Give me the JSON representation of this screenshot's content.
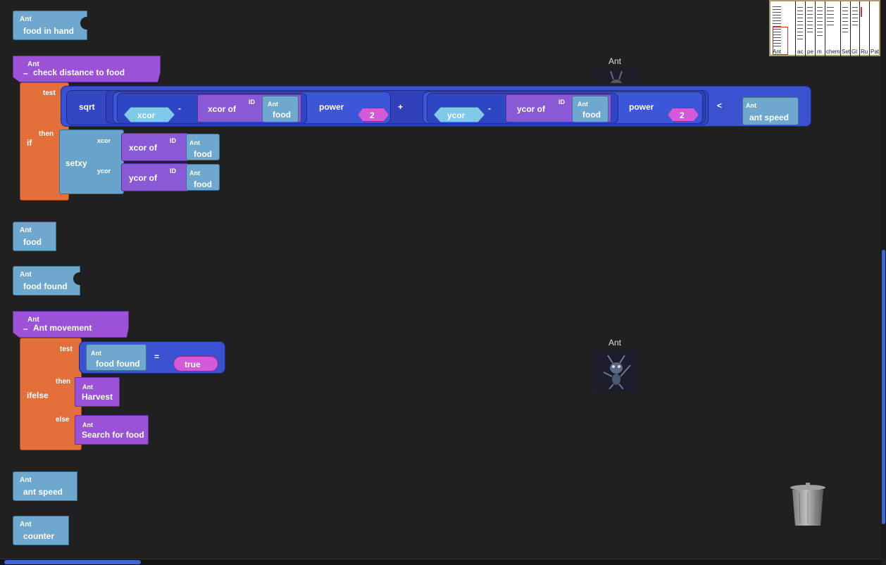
{
  "blocks": {
    "food_in_hand": {
      "prefix": "Ant",
      "name": "food in hand"
    },
    "check_distance": {
      "prefix": "Ant",
      "minus": "–",
      "name": "check distance to food",
      "if_label": "if",
      "test_label": "test",
      "then_label": "then",
      "sqrt": "sqrt",
      "xcor": "xcor",
      "minus_op": "-",
      "xcor_of": "xcor of",
      "id": "ID",
      "ant": "Ant",
      "food": "food",
      "power": "power",
      "two": "2",
      "plus": "+",
      "ycor": "ycor",
      "ycor_of": "ycor of",
      "lt": "<",
      "ant_speed": "ant speed",
      "setxy": "setxy",
      "set_xcor": "xcor",
      "set_ycor": "ycor"
    },
    "food": {
      "prefix": "Ant",
      "name": "food"
    },
    "food_found": {
      "prefix": "Ant",
      "name": "food found"
    },
    "ant_movement": {
      "prefix": "Ant",
      "minus": "–",
      "name": "Ant movement",
      "ifelse_label": "ifelse",
      "test_label": "test",
      "then_label": "then",
      "else_label": "else",
      "eq": "=",
      "true_val": "true",
      "harvest": "Harvest",
      "search": "Search for food"
    },
    "ant_speed": {
      "prefix": "Ant",
      "name": "ant speed"
    },
    "counter": {
      "prefix": "Ant",
      "name": "counter"
    }
  },
  "agents": {
    "top_label": "Ant",
    "bottom_label": "Ant"
  },
  "minimap": {
    "labels": [
      "Ant",
      "ac",
      "pe",
      "m",
      "chem",
      "Set",
      "Gl",
      "Ru",
      "Pat"
    ]
  }
}
